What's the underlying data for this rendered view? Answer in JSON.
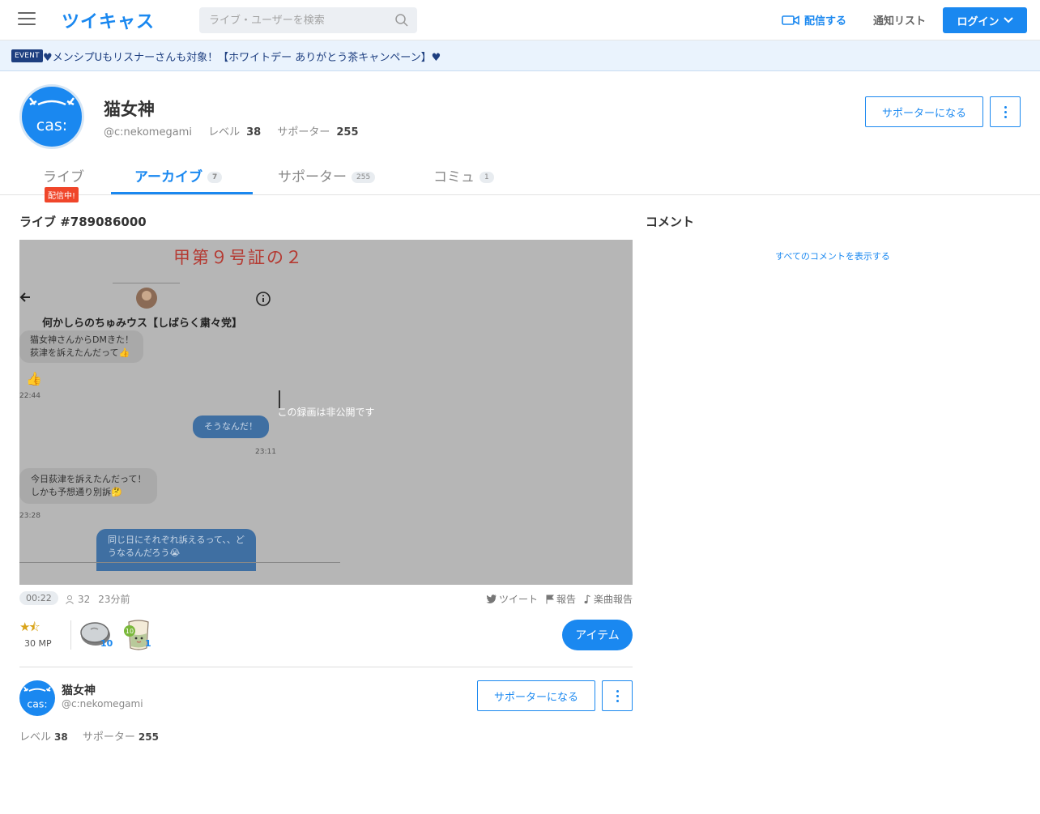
{
  "header": {
    "logo": "ツイキャス",
    "search_placeholder": "ライブ・ユーザーを検索",
    "broadcast_label": "配信する",
    "notify_label": "通知リスト",
    "login_label": "ログイン"
  },
  "event": {
    "tag": "EVENT",
    "text": "♥︎メンシプUもリスナーさんも︎対象！【ホワイトデー ありがとう茶キャンペーン】︎♥"
  },
  "profile": {
    "name": "猫女神",
    "handle": "@c:nekomegami",
    "level_label": "レベル",
    "level": "38",
    "supporters_label": "サポーター",
    "supporters": "255",
    "support_button": "サポーターになる",
    "avatar_text": "cas:"
  },
  "tabs": [
    {
      "label": "ライブ",
      "count": ""
    },
    {
      "label": "アーカイブ",
      "count": "7"
    },
    {
      "label": "サポーター",
      "count": "255"
    },
    {
      "label": "コミュ",
      "count": "1"
    }
  ],
  "live_badge": "配信中!",
  "live": {
    "title": "ライブ #789086000",
    "private_notice": "この録画は非公開です",
    "duration": "00:22",
    "viewers": "32",
    "time_ago": "23分前",
    "tweet": "ツイート",
    "report": "報告",
    "music_report": "楽曲報告",
    "rating_mp": "30 MP",
    "item_button": "アイテム",
    "gift1_count": "10",
    "gift2_count": "1",
    "gift2_badge": "10"
  },
  "video_content": {
    "doc_title": "甲第９号証の２",
    "chat_title": "何かしらのちゅみウス【しばらく粛々党】",
    "msg1": "猫女神さんからDMきた！",
    "msg1b": "荻津を訴えたんだって👍",
    "msg_thumb": "👍",
    "ts1": "22:44",
    "msg2": "そうなんだ！",
    "ts2": "23:11",
    "msg3": "今日荻津を訴えたんだって！",
    "msg3b": "しかも予想通り別訴🤔",
    "ts3": "23:28",
    "msg4": "同じ日にそれぞれ訴えるって、、ど",
    "msg4b": "うなるんだろう😭"
  },
  "comments": {
    "title": "コメント",
    "show_all": "すべてのコメントを表示する"
  },
  "colors": {
    "accent": "#1a88f0",
    "live_badge": "#f0462a",
    "event_bg": "#eaf3fd"
  }
}
